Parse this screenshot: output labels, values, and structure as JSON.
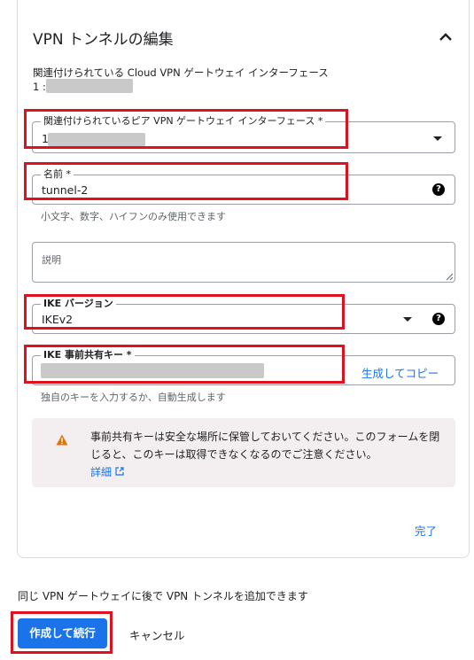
{
  "panel": {
    "title": "VPN トンネルの編集",
    "collapse_icon": "chevron-up-icon",
    "associated_interface": {
      "label": "関連付けられている Cloud VPN ゲートウェイ インターフェース",
      "value_prefix": "1 :"
    },
    "peer_interface": {
      "label": "関連付けられているピア VPN ゲートウェイ インターフェース *",
      "value_prefix": "1 :"
    },
    "name": {
      "label": "名前 *",
      "value": "tunnel-2",
      "hint": "小文字、数字、ハイフンのみ使用できます"
    },
    "description": {
      "placeholder": "説明"
    },
    "ike_version": {
      "label": "IKE バージョン",
      "value": "IKEv2"
    },
    "ike_key": {
      "label": "IKE 事前共有キー *",
      "generate_label": "生成してコピー",
      "hint": "独自のキーを入力するか、自動生成します"
    },
    "notice": {
      "text": "事前共有キーは安全な場所に保管しておいてください。このフォームを閉じると、このキーは取得できなくなるのでご注意ください。",
      "link_label": "詳細",
      "icon": "warning-icon"
    },
    "done_label": "完了"
  },
  "footer": {
    "info_text": "同じ VPN ゲートウェイに後で VPN トンネルを追加できます",
    "create_label": "作成して続行",
    "cancel_label": "キャンセル"
  },
  "colors": {
    "accent": "#1a73e8",
    "highlight": "#e0101e",
    "warning": "#e37400"
  }
}
